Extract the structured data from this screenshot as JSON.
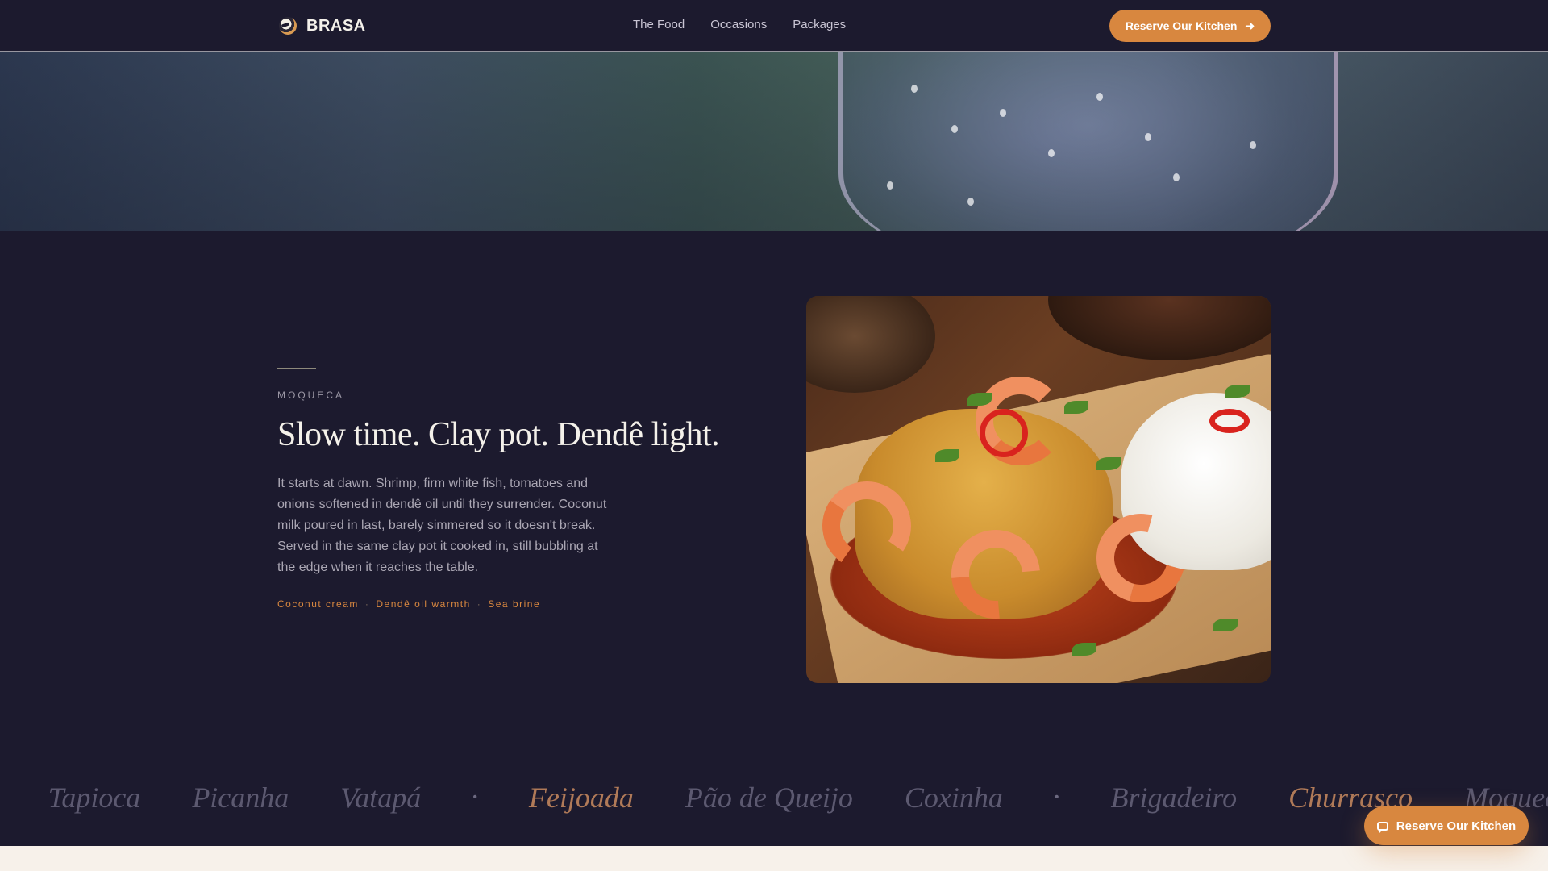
{
  "brand": {
    "name": "BRASA",
    "logo_icon": "bird-logo-icon"
  },
  "nav": {
    "links": [
      "The Food",
      "Occasions",
      "Packages"
    ],
    "cta_label": "Reserve Our Kitchen",
    "cta_icon": "arrow-right-icon"
  },
  "feature": {
    "eyebrow": "MOQUECA",
    "headline": "Slow time. Clay pot. Dendê light.",
    "body": "It starts at dawn. Shrimp, firm white fish, tomatoes and onions softened in dendê oil until they surrender. Coconut milk poured in last, barely simmered so it doesn't break. Served in the same clay pot it cooked in, still bubbling at the edge when it reaches the table.",
    "tags": [
      "Coconut cream",
      "Dendê oil warmth",
      "Sea brine"
    ],
    "tag_separator": "·"
  },
  "marquee": {
    "items": [
      "Tapioca",
      "Picanha",
      "Vatapá",
      "Feijoada",
      "Pão de Queijo",
      "Coxinha",
      "Brigadeiro",
      "Churrasco",
      "Moqueca"
    ],
    "separator": "•"
  },
  "floating_cta": {
    "label": "Reserve Our Kitchen",
    "icon": "chat-icon"
  },
  "colors": {
    "background": "#1c1a2e",
    "accent": "#d8873f",
    "cream": "#f7f1ea"
  }
}
